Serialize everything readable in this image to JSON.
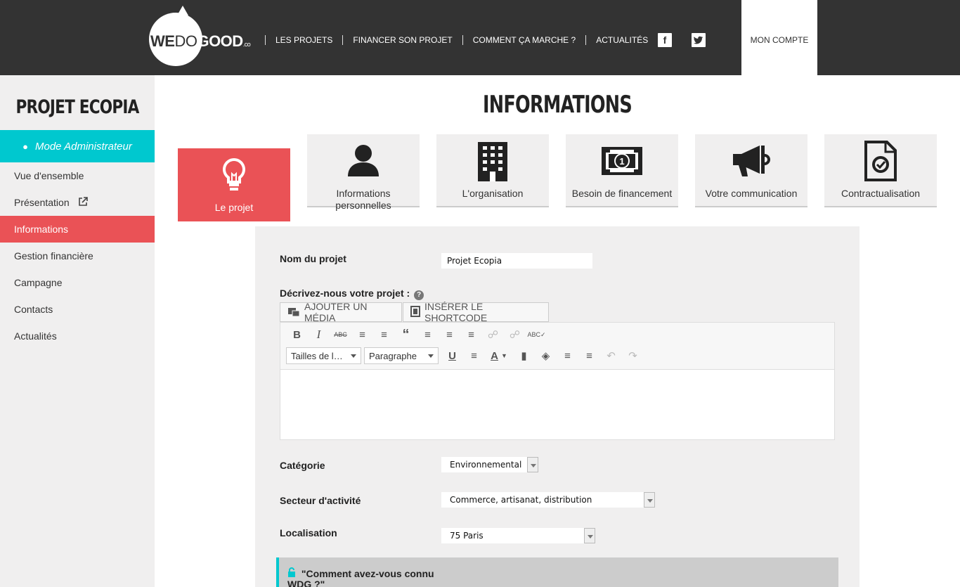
{
  "header": {
    "logo": "WEDOGOOD.co",
    "nav": [
      "LES PROJETS",
      "FINANCER SON PROJET",
      "COMMENT ÇA MARCHE ?",
      "ACTUALITÉS"
    ],
    "account": "MON COMPTE",
    "social": {
      "facebook": "f",
      "twitter": "t"
    }
  },
  "sidebar": {
    "project_title": "PROJET ECOPIA",
    "admin_mode": "Mode Administrateur",
    "items": [
      {
        "label": "Vue d'ensemble"
      },
      {
        "label": "Présentation"
      },
      {
        "label": "Informations",
        "active": true
      },
      {
        "label": "Gestion financière"
      },
      {
        "label": "Campagne"
      },
      {
        "label": "Contacts"
      },
      {
        "label": "Actualités"
      }
    ]
  },
  "main": {
    "title": "INFORMATIONS",
    "tabs": [
      {
        "label": "Le projet",
        "icon": "lightbulb-icon",
        "active": true
      },
      {
        "label": "Informations personnelles",
        "icon": "person-icon"
      },
      {
        "label": "L'organisation",
        "icon": "building-icon"
      },
      {
        "label": "Besoin de financement",
        "icon": "banknote-icon"
      },
      {
        "label": "Votre communication",
        "icon": "megaphone-icon"
      },
      {
        "label": "Contractualisation",
        "icon": "contract-icon"
      }
    ]
  },
  "form": {
    "name_label": "Nom du projet",
    "name_value": "Projet Ecopia",
    "describe_label": "Décrivez-nous votre projet :",
    "add_media": "AJOUTER UN MÉDIA",
    "insert_shortcode": "INSÉRER LE SHORTCODE",
    "font_size_dd": "Tailles de l…",
    "paragraph_dd": "Paragraphe",
    "category_label": "Catégorie",
    "category_value": "Environnemental",
    "sector_label": "Secteur d'activité",
    "sector_value": "Commerce, artisanat, distribution",
    "location_label": "Localisation",
    "location_value": "75 Paris",
    "notice_text": "\"Comment avez-vous connu WDG ?\""
  },
  "colors": {
    "accent": "#ea5256",
    "admin": "#00c8cf",
    "topbar": "#333333"
  }
}
